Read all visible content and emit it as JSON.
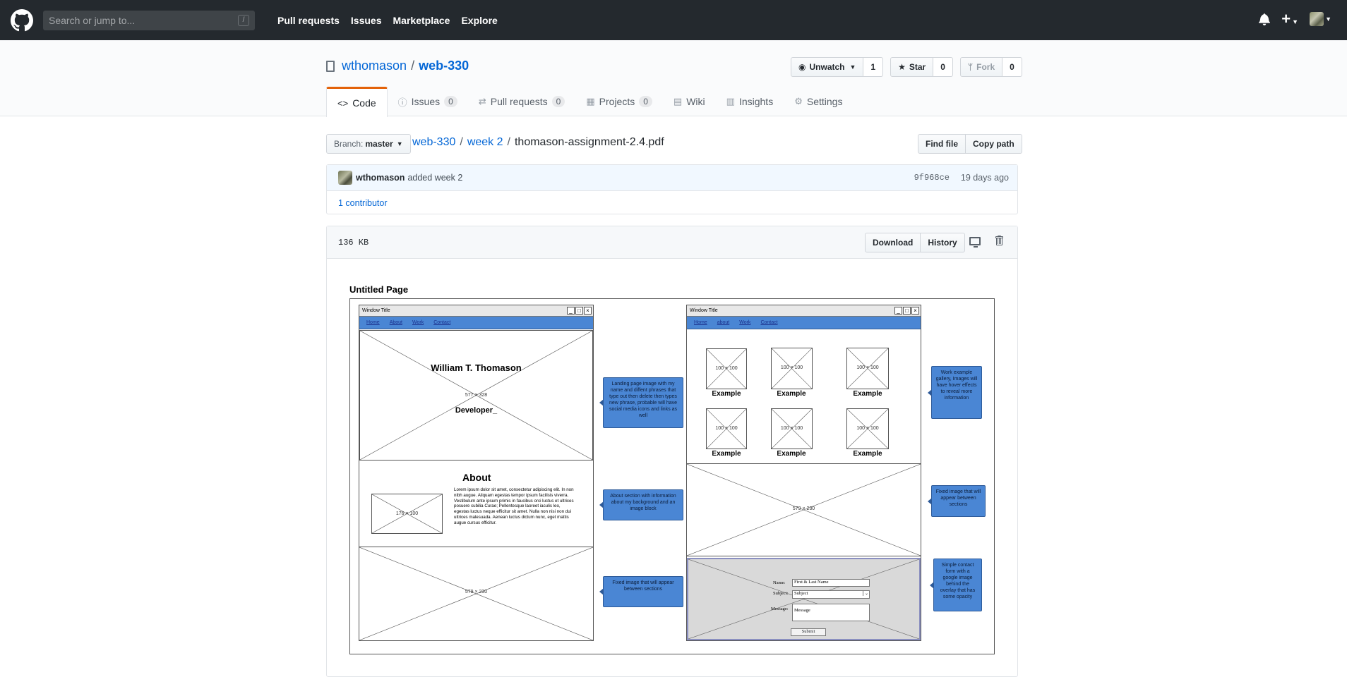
{
  "header": {
    "search_placeholder": "Search or jump to...",
    "search_shortcut": "/",
    "nav": [
      "Pull requests",
      "Issues",
      "Marketplace",
      "Explore"
    ],
    "plus_label": "+"
  },
  "repo": {
    "owner": "wthomason",
    "separator": "/",
    "name": "web-330",
    "watch_label": "Unwatch",
    "watch_count": "1",
    "star_label": "Star",
    "star_count": "0",
    "fork_label": "Fork",
    "fork_count": "0"
  },
  "tabs": [
    {
      "label": "Code",
      "icon": "code-icon",
      "count": ""
    },
    {
      "label": "Issues",
      "icon": "issue-icon",
      "count": "0"
    },
    {
      "label": "Pull requests",
      "icon": "pull-request-icon",
      "count": "0"
    },
    {
      "label": "Projects",
      "icon": "project-icon",
      "count": "0"
    },
    {
      "label": "Wiki",
      "icon": "book-icon",
      "count": ""
    },
    {
      "label": "Insights",
      "icon": "graph-icon",
      "count": ""
    },
    {
      "label": "Settings",
      "icon": "gear-icon",
      "count": ""
    }
  ],
  "filenav": {
    "branch_label": "Branch:",
    "branch_value": "master",
    "crumbs": [
      "web-330",
      "week 2"
    ],
    "filename": "thomason-assignment-2.4.pdf",
    "find_file": "Find file",
    "copy_path": "Copy path"
  },
  "commit": {
    "author": "wthomason",
    "message": "added week 2",
    "sha": "9f968ce",
    "age": "19 days ago",
    "contributors": "1 contributor"
  },
  "file": {
    "size": "136 KB",
    "download": "Download",
    "history": "History"
  },
  "wireframe": {
    "page_title": "Untitled Page",
    "window_title": "Window Title",
    "nav_left": [
      "Home",
      "About",
      "Work",
      "Contact"
    ],
    "nav_right": [
      "Home",
      "about",
      "Work",
      "Contact"
    ],
    "hero_name": "William T. Thomason",
    "hero_dim": "577 × 328",
    "hero_role": "Developer_",
    "about_title": "About",
    "about_dim": "176 × 100",
    "about_text": "Lorem ipsum dolor sit amet, consectetur adipiscing elit. In non nibh augue. Aliquam egestas tempor ipsum facilisis viverra. Vestibulum ante ipsum primis in faucibus orci luctus et ultrices posuere cubilia Curae; Pellentesque laoreet iaculis leo, egestas luctus neque efficitur sit amet. Nulla non nisi non dui ultrices malesuada. Aenean luctus dictum nunc, eget mattis augue cursus efficitur.",
    "left_fixed_dim": "579 × 230",
    "gallery_dims": [
      "100 × 100",
      "100 × 100",
      "100 × 100",
      "100 × 100",
      "100 × 100",
      "100 × 100"
    ],
    "gallery_label": "Example",
    "right_fixed_dim": "579 × 230",
    "form_name_label": "Name:",
    "form_name_value": "First & Last Name",
    "form_subject_label": "Subject:",
    "form_subject_value": "Subject",
    "form_message_label": "Message:",
    "form_message_value": "Message",
    "form_submit": "Submit",
    "notes": [
      "Landing page image with my name and diffent phrases that type out then delete then types new phrase, probable will have social media icons and links as well",
      "About section with information about my background and an image block",
      "Fixed image that will appear between sections",
      "Work example gallery, Images will have hover effects to reveal more information",
      "Fixed image that will appear between sections",
      "Simple contact form with a google image behind the overlay that has some opacity"
    ]
  }
}
